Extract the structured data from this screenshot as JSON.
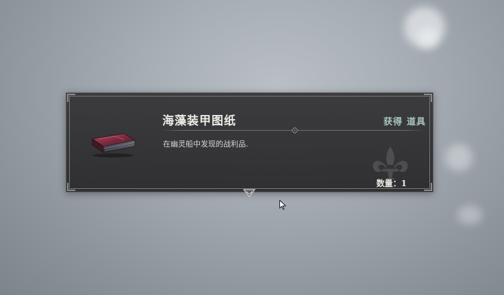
{
  "notification": {
    "item_name": "海藻装甲图纸",
    "acquire_label": "获得",
    "category": "道具",
    "description": "在幽灵船中发现的战利品.",
    "quantity_label": "数量：",
    "quantity_value": "1"
  },
  "icons": {
    "item": "blueprint-book-icon",
    "emblem": "fleur-de-lis-icon",
    "expand": "chevron-down-icon",
    "pointer": "mouse-cursor-icon"
  },
  "colors": {
    "panel": "#2e2e30",
    "accent_text": "#a9c5c1",
    "item_book": "#7a2a3a"
  }
}
